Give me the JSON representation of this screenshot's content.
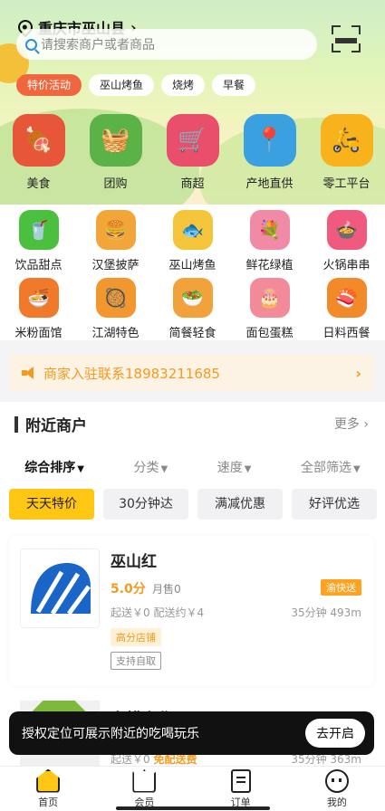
{
  "header": {
    "location": "重庆市巫山县",
    "search_placeholder": "请搜索商户或者商品",
    "tags": [
      {
        "label": "特价活动",
        "active": true
      },
      {
        "label": "巫山烤鱼",
        "active": false
      },
      {
        "label": "烧烤",
        "active": false
      },
      {
        "label": "早餐",
        "active": false
      }
    ]
  },
  "categories_main": [
    {
      "label": "美食",
      "icon": "meat-icon",
      "color": "#e8563a"
    },
    {
      "label": "团购",
      "icon": "basket-icon",
      "color": "#5bb347"
    },
    {
      "label": "商超",
      "icon": "cart-icon",
      "color": "#e94e6a"
    },
    {
      "label": "产地直供",
      "icon": "map-pin-icon",
      "color": "#3aa0e0"
    },
    {
      "label": "零工平台",
      "icon": "courier-icon",
      "color": "#f7b21c"
    }
  ],
  "categories_row2": [
    {
      "label": "饮品甜点",
      "icon": "drink-icon",
      "color": "#4bbf3e"
    },
    {
      "label": "汉堡披萨",
      "icon": "burger-icon",
      "color": "#f2a63a"
    },
    {
      "label": "巫山烤鱼",
      "icon": "fish-icon",
      "color": "#f4c53a"
    },
    {
      "label": "鲜花绿植",
      "icon": "flower-icon",
      "color": "#f08aa6"
    },
    {
      "label": "火锅串串",
      "icon": "hotpot-icon",
      "color": "#ef5a7e"
    }
  ],
  "categories_row3": [
    {
      "label": "米粉面馆",
      "icon": "noodle-icon",
      "color": "#f07a2a"
    },
    {
      "label": "江湖特色",
      "icon": "bowl-icon",
      "color": "#f2962e"
    },
    {
      "label": "简餐轻食",
      "icon": "salad-icon",
      "color": "#f2a23a"
    },
    {
      "label": "面包蛋糕",
      "icon": "cake-icon",
      "color": "#f28a9a"
    },
    {
      "label": "日料西餐",
      "icon": "sushi-icon",
      "color": "#f28a2a"
    }
  ],
  "notice": {
    "text": "商家入驻联系18983211685"
  },
  "nearby": {
    "title": "附近商户",
    "more": "更多",
    "sort": [
      {
        "label": "综合排序",
        "active": true
      },
      {
        "label": "分类",
        "active": false
      },
      {
        "label": "速度",
        "active": false
      },
      {
        "label": "全部筛选",
        "active": false
      }
    ],
    "filters": [
      {
        "label": "天天特价",
        "active": true
      },
      {
        "label": "30分钟达",
        "active": false
      },
      {
        "label": "满减优惠",
        "active": false
      },
      {
        "label": "好评优选",
        "active": false
      }
    ],
    "shops": [
      {
        "name": "巫山红",
        "rating": "5.0分",
        "sold": "月售0",
        "express": "渝快送",
        "fees": "起送￥0  配送约￥4",
        "distance": "35分钟  493m",
        "badge": "高分店铺",
        "pickup": "支持自取"
      },
      {
        "name": "安耕农业",
        "fees_prefix": "起送￥0",
        "free_delivery": "免配送费",
        "distance": "35分钟  363m"
      }
    ]
  },
  "toast": {
    "text": "授权定位可展示附近的吃喝玩乐",
    "button": "去开启"
  },
  "tabbar": [
    {
      "label": "首页",
      "icon": "home-icon"
    },
    {
      "label": "会员",
      "icon": "crown-icon"
    },
    {
      "label": "订单",
      "icon": "order-icon"
    },
    {
      "label": "我的",
      "icon": "profile-icon"
    }
  ]
}
